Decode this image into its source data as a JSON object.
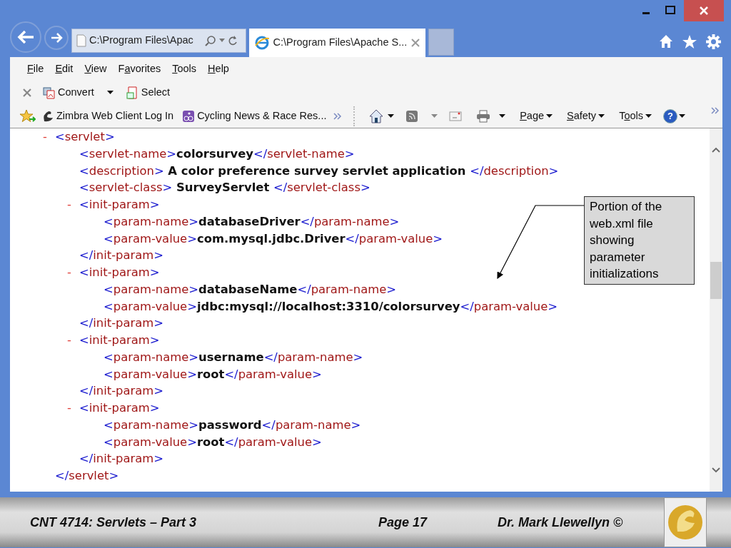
{
  "address_bar": {
    "value": "C:\\Program Files\\Apac"
  },
  "tab": {
    "title": "C:\\Program Files\\Apache S..."
  },
  "menu": [
    {
      "key": "F",
      "post": "ile"
    },
    {
      "key": "E",
      "post": "dit"
    },
    {
      "key": "V",
      "post": "iew"
    },
    {
      "pre": "F",
      "key": "a",
      "post": "vorites"
    },
    {
      "key": "T",
      "post": "ools"
    },
    {
      "key": "H",
      "post": "elp"
    }
  ],
  "toolbar": [
    {
      "kind": "convert",
      "label": "Convert",
      "dropdown": true
    },
    {
      "kind": "select",
      "label": "Select",
      "dropdown": false
    }
  ],
  "favorites": [
    {
      "kind": "zimbra",
      "label": "Zimbra Web Client Log In"
    },
    {
      "kind": "cycling",
      "label": "Cycling News & Race Res..."
    }
  ],
  "command_bar": [
    {
      "key": "P",
      "post": "age"
    },
    {
      "key": "S",
      "post": "afety"
    },
    {
      "pre": "T",
      "key": "o",
      "post": "ols"
    }
  ],
  "help_button": {
    "label": "?"
  },
  "xml": {
    "toggle": "-",
    "open": "<servlet>",
    "close": "</servlet>",
    "children": [
      {
        "open": "<servlet-name>",
        "text": "colorsurvey",
        "close": "</servlet-name>"
      },
      {
        "open": "<description>",
        "text": " A color preference survey servlet application ",
        "close": "</description>"
      },
      {
        "open": "<servlet-class>",
        "text": " SurveyServlet ",
        "close": "</servlet-class>"
      },
      {
        "toggle": "-",
        "open": "<init-param>",
        "close": "</init-param>",
        "children": [
          {
            "open": "<param-name>",
            "text": "databaseDriver",
            "close": "</param-name>"
          },
          {
            "open": "<param-value>",
            "text": "com.mysql.jdbc.Driver",
            "close": "</param-value>"
          }
        ]
      },
      {
        "toggle": "-",
        "open": "<init-param>",
        "close": "</init-param>",
        "children": [
          {
            "open": "<param-name>",
            "text": "databaseName",
            "close": "</param-name>"
          },
          {
            "open": "<param-value>",
            "text": "jdbc:mysql://localhost:3310/colorsurvey",
            "close": "</param-value>"
          }
        ]
      },
      {
        "toggle": "-",
        "open": "<init-param>",
        "close": "</init-param>",
        "children": [
          {
            "open": "<param-name>",
            "text": "username",
            "close": "</param-name>"
          },
          {
            "open": "<param-value>",
            "text": "root",
            "close": "</param-value>"
          }
        ]
      },
      {
        "toggle": "-",
        "open": "<init-param>",
        "close": "</init-param>",
        "children": [
          {
            "open": "<param-name>",
            "text": "password",
            "close": "</param-name>"
          },
          {
            "open": "<param-value>",
            "text": "root",
            "close": "</param-value>"
          }
        ]
      }
    ]
  },
  "callout": {
    "text": "Portion of the web.xml file showing parameter initializations"
  },
  "footer": {
    "course": "CNT 4714: Servlets – Part 3",
    "page": "Page 17",
    "author": "Dr. Mark Llewellyn ©"
  }
}
